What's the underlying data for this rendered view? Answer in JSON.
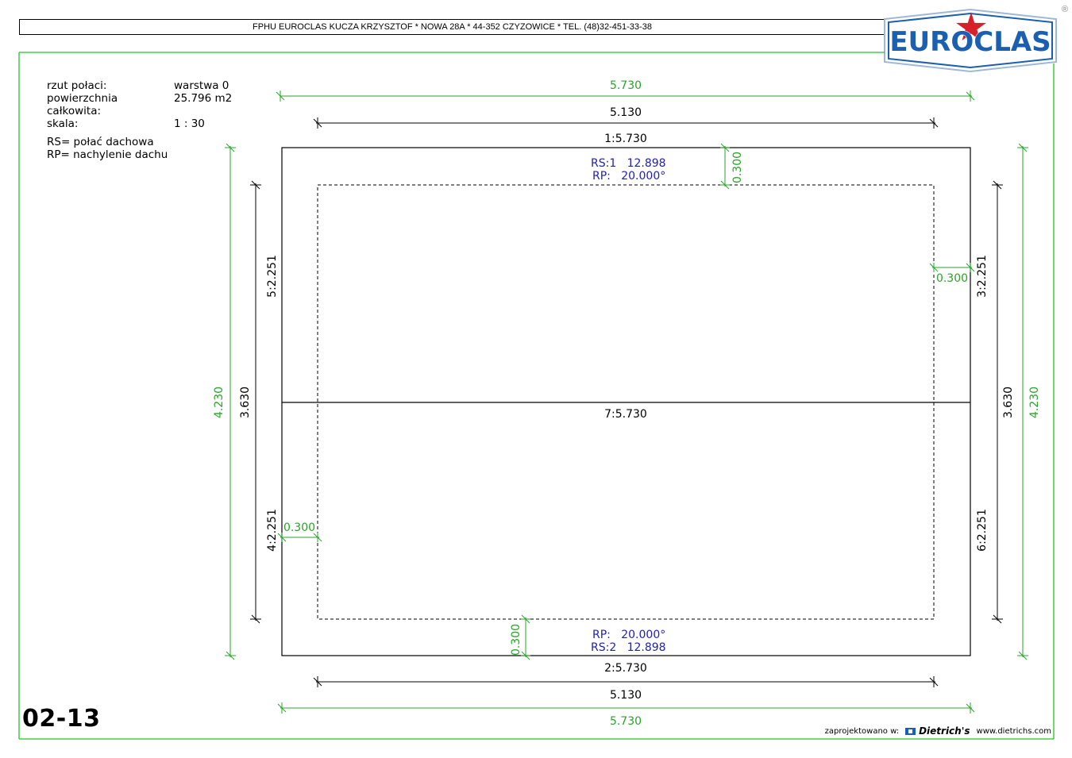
{
  "header": {
    "company_line": "FPHU EUROCLAS KUCZA KRZYSZTOF * NOWA 28A * 44-352 CZYZOWICE * TEL. (48)32-451-33-38",
    "logo_text": "EUROCLAS",
    "registered_mark": "®"
  },
  "info": {
    "plan_label": "rzut połaci:",
    "plan_value": "warstwa 0",
    "area_label": "powierzchnia całkowita:",
    "area_value": "25.796 m2",
    "scale_label": "skala:",
    "scale_value": "1 : 30"
  },
  "legend": {
    "rs": "RS= połać dachowa",
    "rp": "RP= nachylenie dachu"
  },
  "drawing": {
    "dim_top_outer": "5.730",
    "dim_top_inner": "5.130",
    "edge_top": "1:5.730",
    "rs1": "RS:1   12.898",
    "rp1": "RP:   20.000°",
    "offset_top": "0.300",
    "offset_right": "0.300",
    "offset_left": "0.300",
    "offset_bottom": "0.300",
    "edge_left_upper": "5:2.251",
    "edge_left_lower": "4:2.251",
    "edge_right_upper": "3:2.251",
    "edge_right_lower": "6:2.251",
    "dim_left_outer": "4.230",
    "dim_left_inner": "3.630",
    "dim_right_inner": "3.630",
    "dim_right_outer": "4.230",
    "ridge": "7:5.730",
    "rp2": "RP:   20.000°",
    "rs2": "RS:2   12.898",
    "edge_bottom": "2:5.730",
    "dim_bottom_inner": "5.130",
    "dim_bottom_outer": "5.730"
  },
  "colors": {
    "frame_green": "#22c422",
    "dim_green": "#2aa32a",
    "label_blue": "#2222aa",
    "logo_blue": "#1b5fb0",
    "logo_red": "#d8202a"
  },
  "sheet_number": "02-13",
  "footer": {
    "designed_with": "zaprojektowano w:",
    "brand": "Dietrich's",
    "url": "www.dietrichs.com"
  }
}
